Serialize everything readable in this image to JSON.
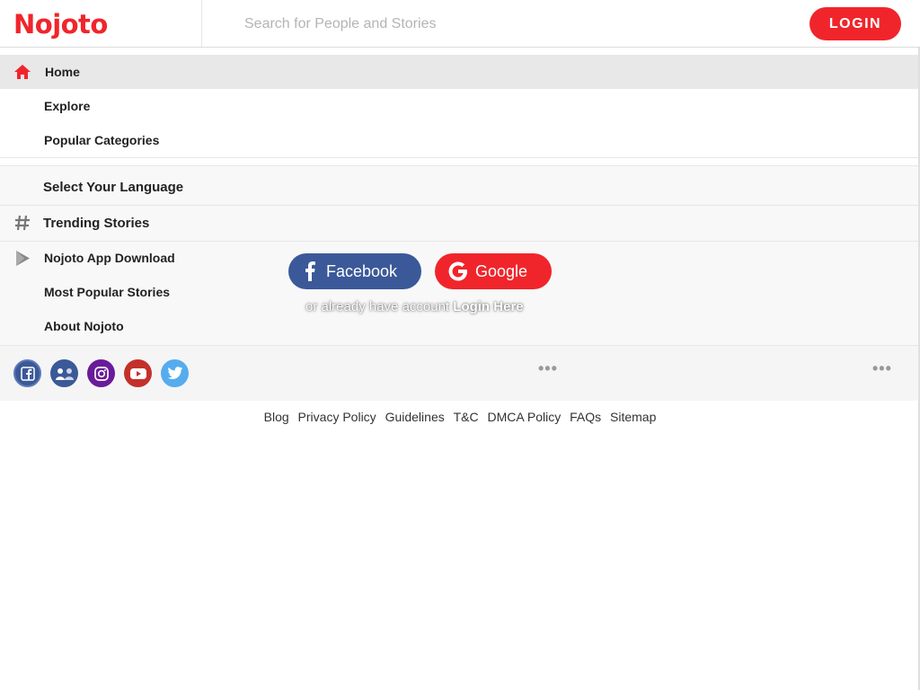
{
  "header": {
    "logo_text": "Nojoto",
    "search_placeholder": "Search for People and Stories",
    "login_label": "LOGIN"
  },
  "menu": {
    "home": "Home",
    "explore": "Explore",
    "popular_categories": "Popular Categories",
    "select_language": "Select Your Language",
    "trending_stories": "Trending Stories",
    "app_download": "Nojoto App Download",
    "most_popular": "Most Popular Stories",
    "about": "About Nojoto"
  },
  "auth": {
    "facebook_label": "Facebook",
    "google_label": "Google",
    "already_text": "or already have account",
    "login_here": "Login Here"
  },
  "social_icons": [
    "facebook-icon",
    "group-icon",
    "instagram-icon",
    "youtube-icon",
    "twitter-icon"
  ],
  "footer_links": [
    "Blog",
    "Privacy Policy",
    "Guidelines",
    "T&C",
    "DMCA Policy",
    "FAQs",
    "Sitemap"
  ],
  "colors": {
    "brand_red": "#f0252b",
    "facebook_blue": "#3b5998",
    "home_bg": "#e8e8e8"
  }
}
